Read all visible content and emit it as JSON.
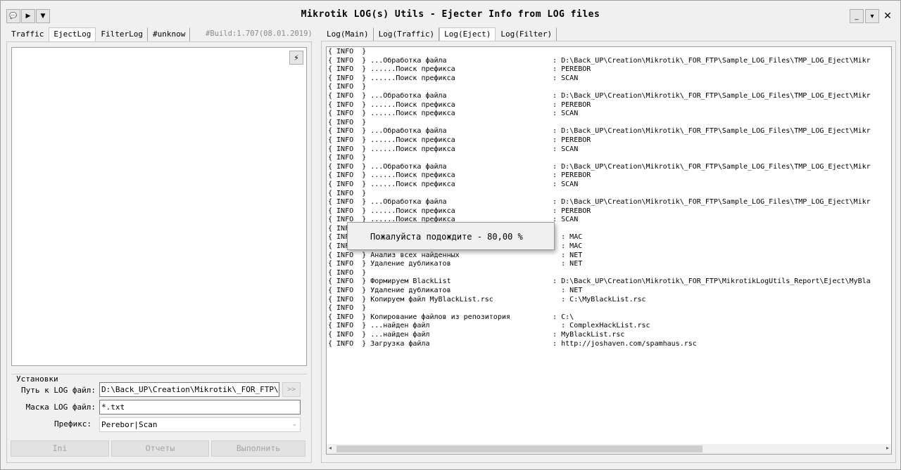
{
  "window": {
    "title": "Mikrotik LOG(s) Utils - Ejecter Info from LOG files",
    "minimize": "_",
    "maximize": "▾",
    "close": "✕"
  },
  "toolbar": {
    "chat": "💬",
    "play": "▶",
    "menu": "▼"
  },
  "left_tabs": [
    "Traffic",
    "EjectLog",
    "FilterLog",
    "#unknow"
  ],
  "left_active_tab": "EjectLog",
  "build": "#Build:1.707(08.01.2019)",
  "pin_icon": "⚡",
  "settings": {
    "legend": "Установки",
    "path_label": "Путь к LOG файл:",
    "path_value": "D:\\Back_UP\\Creation\\Mikrotik\\_FOR_FTP\\Sa",
    "browse": ">>",
    "mask_label": "Маска LOG файл:",
    "mask_value": "*.txt",
    "prefix_label": "Префикс:",
    "prefix_value": "Perebor|Scan"
  },
  "buttons": {
    "ini": "Ini",
    "reports": "Отчеты",
    "run": "Выполнить"
  },
  "right_tabs": [
    "Log(Main)",
    "Log(Traffic)",
    "Log(Eject)",
    "Log(Filter)"
  ],
  "right_active_tab": "Log(Eject)",
  "log_lines": [
    "{ INFO  }",
    "{ INFO  } ...Обработка файла                         : D:\\Back_UP\\Creation\\Mikrotik\\_FOR_FTP\\Sample_LOG_Files\\TMP_LOG_Eject\\Mikr",
    "{ INFO  } ......Поиск префикса                       : PEREBOR",
    "{ INFO  } ......Поиск префикса                       : SCAN",
    "{ INFO  }",
    "{ INFO  } ...Обработка файла                         : D:\\Back_UP\\Creation\\Mikrotik\\_FOR_FTP\\Sample_LOG_Files\\TMP_LOG_Eject\\Mikr",
    "{ INFO  } ......Поиск префикса                       : PEREBOR",
    "{ INFO  } ......Поиск префикса                       : SCAN",
    "{ INFO  }",
    "{ INFO  } ...Обработка файла                         : D:\\Back_UP\\Creation\\Mikrotik\\_FOR_FTP\\Sample_LOG_Files\\TMP_LOG_Eject\\Mikr",
    "{ INFO  } ......Поиск префикса                       : PEREBOR",
    "{ INFO  } ......Поиск префикса                       : SCAN",
    "{ INFO  }",
    "{ INFO  } ...Обработка файла                         : D:\\Back_UP\\Creation\\Mikrotik\\_FOR_FTP\\Sample_LOG_Files\\TMP_LOG_Eject\\Mikr",
    "{ INFO  } ......Поиск префикса                       : PEREBOR",
    "{ INFO  } ......Поиск префикса                       : SCAN",
    "{ INFO  }",
    "{ INFO  } ...Обработка файла                         : D:\\Back_UP\\Creation\\Mikrotik\\_FOR_FTP\\Sample_LOG_Files\\TMP_LOG_Eject\\Mikr",
    "{ INFO  } ......Поиск префикса                       : PEREBOR",
    "{ INFO  } ......Поиск префикса                       : SCAN",
    "{ INFO  }",
    "{ INFO  }                                              : MAC",
    "{ INFO  }                                              : MAC",
    "{ INFO  } Анализ всех найденных                        : NET",
    "{ INFO  } Удаление дубликатов                          : NET",
    "{ INFO  }",
    "{ INFO  } Формируем BlackList                        : D:\\Back_UP\\Creation\\Mikrotik\\_FOR_FTP\\MikrotikLogUtils_Report\\Eject\\MyBla",
    "{ INFO  } Удаление дубликатов                          : NET",
    "{ INFO  } Копируем файл MyBlackList.rsc                : C:\\MyBlackList.rsc",
    "{ INFO  }",
    "{ INFO  } Копирование файлов из репозитория          : C:\\",
    "{ INFO  } ...найден файл                               : ComplexHackList.rsc",
    "{ INFO  } ...найден файл                             : MyBlackList.rsc",
    "{ INFO  } Загрузка файла                             : http://joshaven.com/spamhaus.rsc"
  ],
  "popup_text": "Пожалуйста подождите - 80,00 %",
  "scroll": {
    "left": "◂",
    "right": "▸"
  }
}
